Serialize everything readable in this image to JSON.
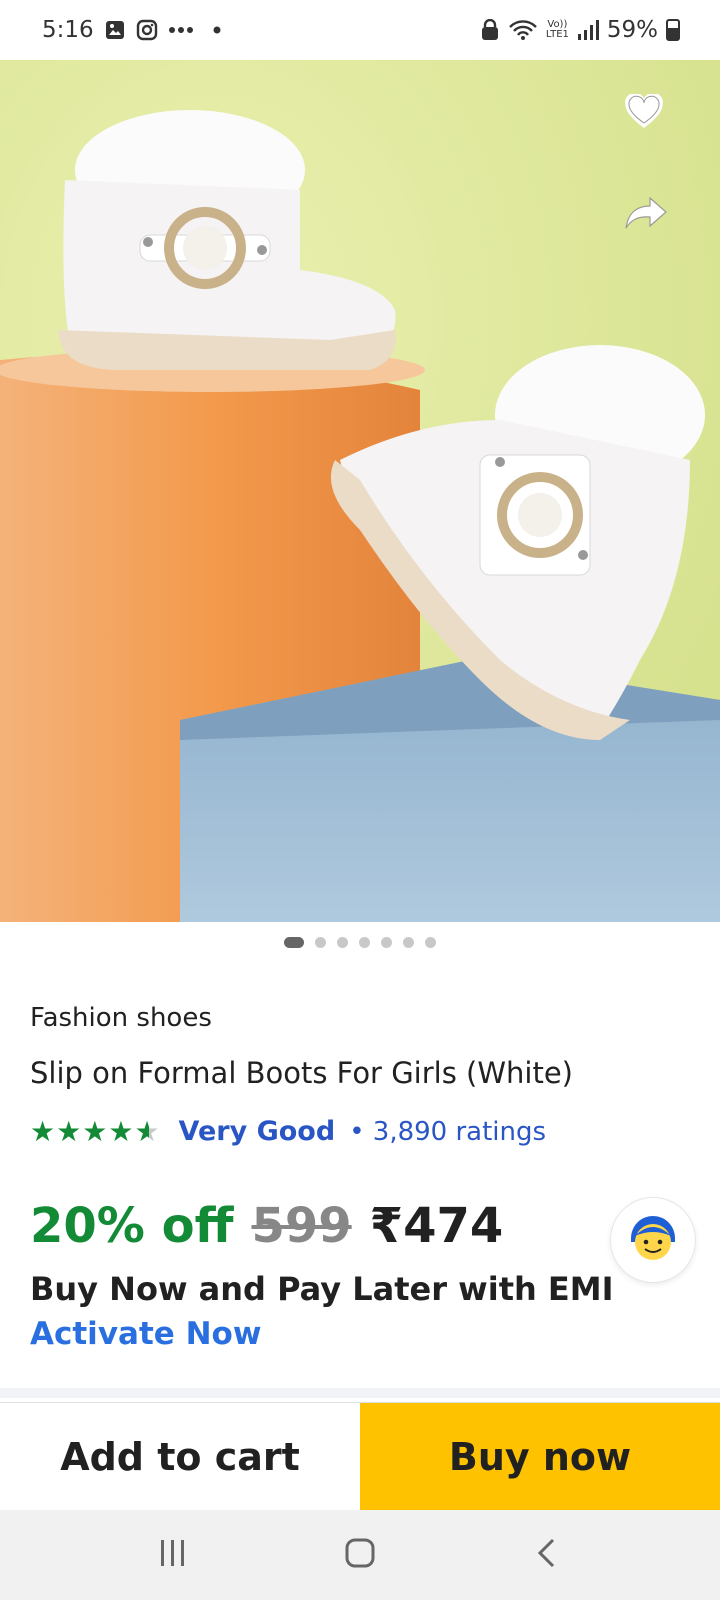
{
  "status_bar": {
    "time": "5:16",
    "battery": "59%",
    "network": "LTE1",
    "volte": "Vo))"
  },
  "hero": {
    "icons": [
      "heart-icon",
      "share-icon"
    ],
    "background_colors": {
      "wall": "#e3e8a0",
      "pedestal": "#f09a4a",
      "block": "#a9c4dc",
      "boot": "#f5f3f3"
    }
  },
  "pager": {
    "count": 7,
    "active": 1
  },
  "product": {
    "brand": "Fashion shoes",
    "title": "Slip on Formal Boots For Girls (White)",
    "stars": [
      "★",
      "★",
      "★",
      "★",
      "★"
    ],
    "rating_label": "Very Good",
    "rating_count": "• 3,890 ratings",
    "discount": "20% off",
    "mrp": "599",
    "price": "₹474",
    "emi_text": "Buy Now and Pay Later with EMI",
    "emi_link": "Activate Now"
  },
  "actions": {
    "add_to_cart": "Add to cart",
    "buy_now": "Buy now"
  },
  "colors": {
    "accent_green": "#138a36",
    "link_blue": "#2a55c5",
    "buy_yellow": "#ffc200"
  }
}
